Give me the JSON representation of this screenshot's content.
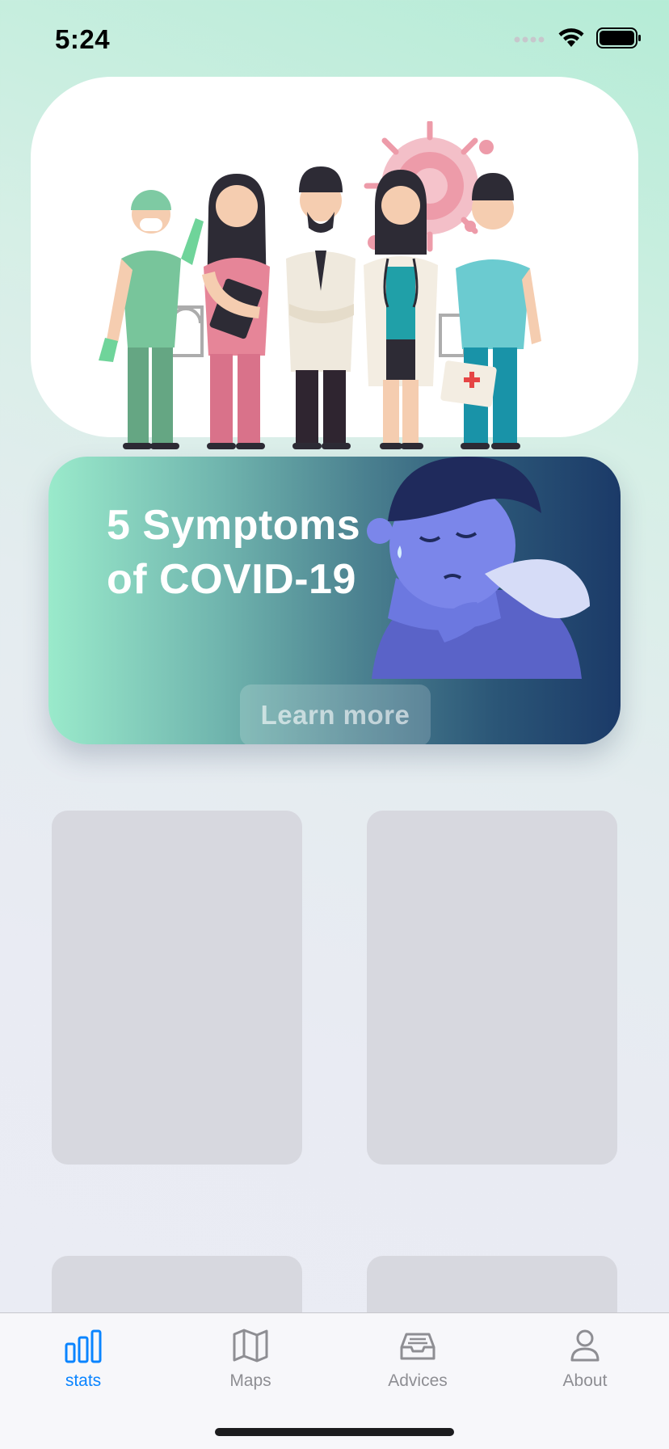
{
  "status_bar": {
    "time": "5:24"
  },
  "promo": {
    "title_line1": "5 Symptoms",
    "title_line2": "of COVID-19",
    "button_label": "Learn more"
  },
  "tab_bar": {
    "items": [
      {
        "label": "stats",
        "icon": "bar-chart-icon",
        "active": true
      },
      {
        "label": "Maps",
        "icon": "map-icon",
        "active": false
      },
      {
        "label": "Advices",
        "icon": "inbox-icon",
        "active": false
      },
      {
        "label": "About",
        "icon": "person-icon",
        "active": false
      }
    ]
  },
  "colors": {
    "accent": "#0a84ff",
    "tab_inactive": "#8e8e93",
    "promo_gradient_start": "#9aeacb",
    "promo_gradient_end": "#1b3a68",
    "placeholder": "#d7d8df"
  }
}
